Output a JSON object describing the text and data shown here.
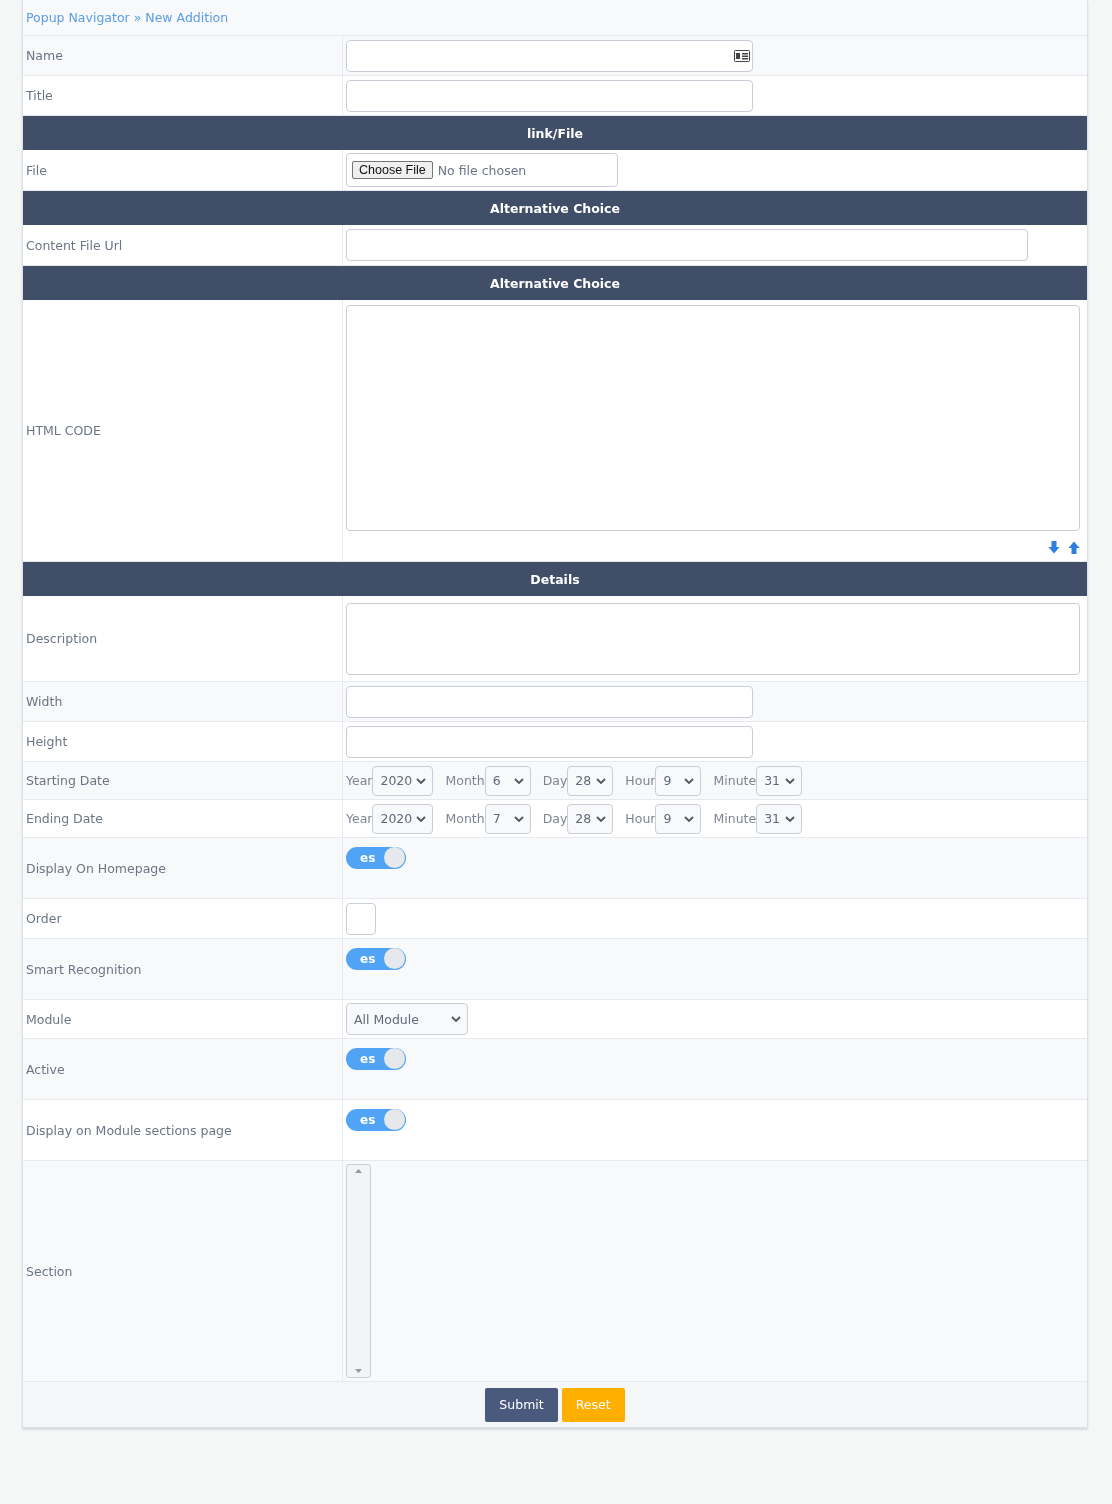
{
  "breadcrumb": {
    "parent": "Popup Navigator",
    "separator": "»",
    "current": "New Addition"
  },
  "rows": [
    {
      "kind": "text",
      "label": "Name",
      "card_icon": true
    },
    {
      "kind": "text",
      "label": "Title"
    },
    {
      "kind": "header",
      "label": "link/File"
    },
    {
      "kind": "file",
      "label": "File",
      "button": "Choose File",
      "status": "No file chosen"
    },
    {
      "kind": "header",
      "label": "Alternative Choice"
    },
    {
      "kind": "url",
      "label": "Content File Url"
    },
    {
      "kind": "header",
      "label": "Alternative Choice"
    },
    {
      "kind": "code",
      "label": "HTML CODE"
    },
    {
      "kind": "header",
      "label": "Details"
    },
    {
      "kind": "area",
      "label": "Description"
    },
    {
      "kind": "text",
      "label": "Width"
    },
    {
      "kind": "text",
      "label": "Height"
    },
    {
      "kind": "date",
      "label": "Starting Date",
      "parts": [
        {
          "label": "Year",
          "value": "2020"
        },
        {
          "label": "Month",
          "value": "6"
        },
        {
          "label": "Day",
          "value": "28"
        },
        {
          "label": "Hour",
          "value": "9"
        },
        {
          "label": "Minute",
          "value": "31"
        }
      ]
    },
    {
      "kind": "date",
      "label": "Ending Date",
      "parts": [
        {
          "label": "Year",
          "value": "2020"
        },
        {
          "label": "Month",
          "value": "7"
        },
        {
          "label": "Day",
          "value": "28"
        },
        {
          "label": "Hour",
          "value": "9"
        },
        {
          "label": "Minute",
          "value": "31"
        }
      ]
    },
    {
      "kind": "toggle",
      "label": "Display On Homepage",
      "text": "es",
      "on": true
    },
    {
      "kind": "order",
      "label": "Order"
    },
    {
      "kind": "toggle",
      "label": "Smart Recognition",
      "text": "es",
      "on": true
    },
    {
      "kind": "select",
      "label": "Module",
      "value": "All Module"
    },
    {
      "kind": "toggle",
      "label": "Active",
      "text": "es",
      "on": true
    },
    {
      "kind": "toggle",
      "label": "Display on Module sections page",
      "text": "es",
      "on": true
    },
    {
      "kind": "list",
      "label": "Section"
    }
  ],
  "buttons": [
    {
      "label": "Submit",
      "kind": "primary"
    },
    {
      "label": "Reset",
      "kind": "warning"
    }
  ]
}
